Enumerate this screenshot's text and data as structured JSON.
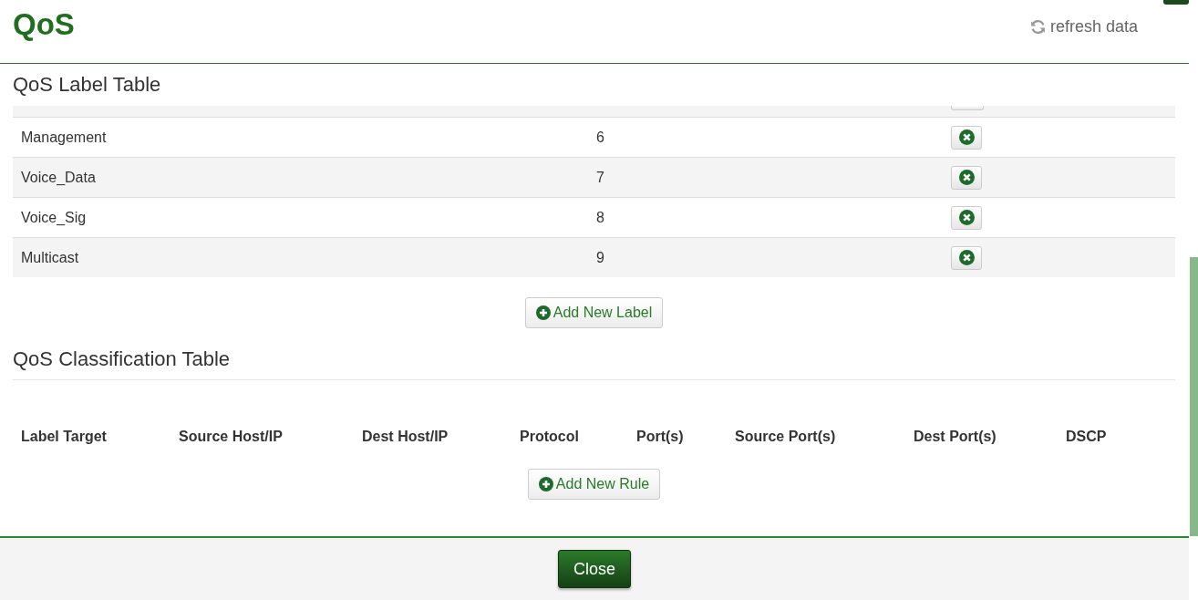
{
  "header": {
    "title": "QoS",
    "refresh": "refresh data"
  },
  "label_table": {
    "title": "QoS Label Table",
    "rows": [
      {
        "name": "Management",
        "value": "6"
      },
      {
        "name": "Voice_Data",
        "value": "7"
      },
      {
        "name": "Voice_Sig",
        "value": "8"
      },
      {
        "name": "Multicast",
        "value": "9"
      }
    ],
    "add_button": "Add New Label"
  },
  "classification_table": {
    "title": "QoS Classification Table",
    "columns": [
      "Label Target",
      "Source Host/IP",
      "Dest Host/IP",
      "Protocol",
      "Port(s)",
      "Source Port(s)",
      "Dest Port(s)",
      "DSCP"
    ],
    "add_button": "Add New Rule"
  },
  "footer": {
    "close_button": "Close"
  }
}
